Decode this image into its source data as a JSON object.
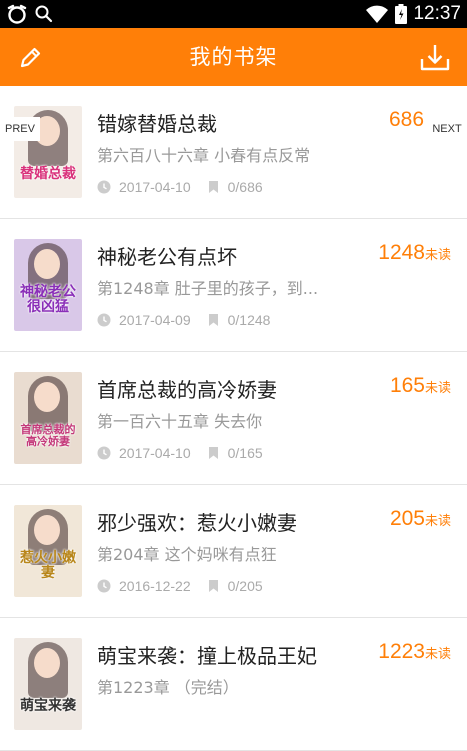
{
  "status_bar": {
    "time": "12:37",
    "icons": [
      "notification-icon",
      "search-icon",
      "wifi-icon",
      "battery-icon"
    ]
  },
  "app_bar": {
    "title": "我的书架",
    "left_icon": "edit-icon",
    "right_icon": "download-icon"
  },
  "pager": {
    "prev_label": "PREV",
    "next_label": "NEXT"
  },
  "colors": {
    "accent": "#ff7f08",
    "title": "#222222",
    "muted": "#999999"
  },
  "books": [
    {
      "title": "错嫁替婚总裁",
      "chapter": "第六百八十六章  小春有点反常",
      "date": "2017-04-10",
      "progress": "0/686",
      "count": "686",
      "unit": "",
      "cover_text": "替婚总裁",
      "cover_color": "#f3ece6"
    },
    {
      "title": "神秘老公有点坏",
      "chapter": "第1248章 肚子里的孩子，到...",
      "date": "2017-04-09",
      "progress": "0/1248",
      "count": "1248",
      "unit": "未读",
      "cover_text": "神秘老公很凶猛",
      "cover_color": "#d9c8e8"
    },
    {
      "title": "首席总裁的高冷娇妻",
      "chapter": "第一百六十五章 失去你",
      "date": "2017-04-10",
      "progress": "0/165",
      "count": "165",
      "unit": "未读",
      "cover_text": "首席总裁的高冷娇妻",
      "cover_color": "#e9dcd0"
    },
    {
      "title": "邪少强欢：惹火小嫩妻",
      "chapter": "第204章  这个妈咪有点狂",
      "date": "2016-12-22",
      "progress": "0/205",
      "count": "205",
      "unit": "未读",
      "cover_text": "惹火小嫩妻",
      "cover_color": "#f1e7d8"
    },
    {
      "title": "萌宝来袭：撞上极品王妃",
      "chapter": "第1223章 （完结）",
      "date": "",
      "progress": "",
      "count": "1223",
      "unit": "未读",
      "cover_text": "萌宝来袭",
      "cover_color": "#efe8e2"
    }
  ]
}
